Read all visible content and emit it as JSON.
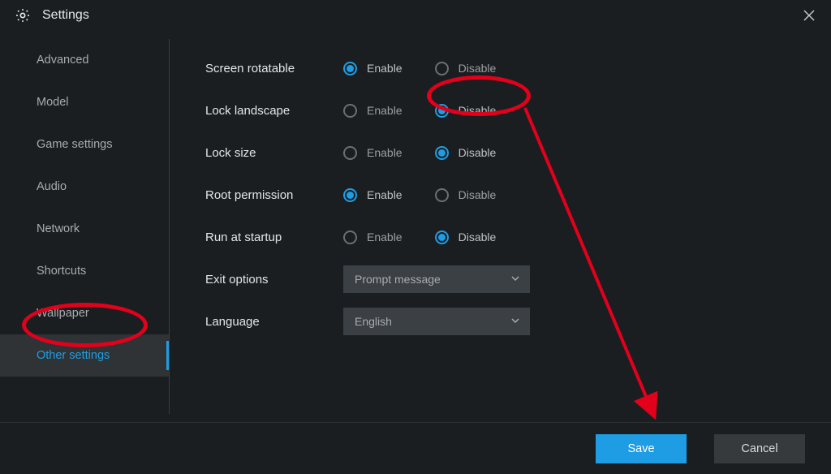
{
  "window": {
    "title": "Settings"
  },
  "sidebar": {
    "items": [
      {
        "id": "advanced",
        "label": "Advanced"
      },
      {
        "id": "model",
        "label": "Model"
      },
      {
        "id": "game-settings",
        "label": "Game settings"
      },
      {
        "id": "audio",
        "label": "Audio"
      },
      {
        "id": "network",
        "label": "Network"
      },
      {
        "id": "shortcuts",
        "label": "Shortcuts"
      },
      {
        "id": "wallpaper",
        "label": "Wallpaper"
      },
      {
        "id": "other-settings",
        "label": "Other settings"
      }
    ],
    "activeId": "other-settings"
  },
  "settings": {
    "radioOptions": {
      "enable": "Enable",
      "disable": "Disable"
    },
    "rows": [
      {
        "id": "screen-rotatable",
        "label": "Screen rotatable",
        "value": "enable"
      },
      {
        "id": "lock-landscape",
        "label": "Lock landscape",
        "value": "disable"
      },
      {
        "id": "lock-size",
        "label": "Lock size",
        "value": "disable"
      },
      {
        "id": "root-permission",
        "label": "Root permission",
        "value": "enable"
      },
      {
        "id": "run-at-startup",
        "label": "Run at startup",
        "value": "disable"
      }
    ],
    "selects": [
      {
        "id": "exit-options",
        "label": "Exit options",
        "value": "Prompt message"
      },
      {
        "id": "language",
        "label": "Language",
        "value": "English"
      }
    ]
  },
  "footer": {
    "save": "Save",
    "cancel": "Cancel"
  },
  "annotations": {
    "circles": [
      "sidebar-other-settings",
      "lock-landscape-disable"
    ],
    "arrow": {
      "from": "lock-landscape-disable",
      "to": "save-button"
    },
    "color": "#e3001b"
  }
}
